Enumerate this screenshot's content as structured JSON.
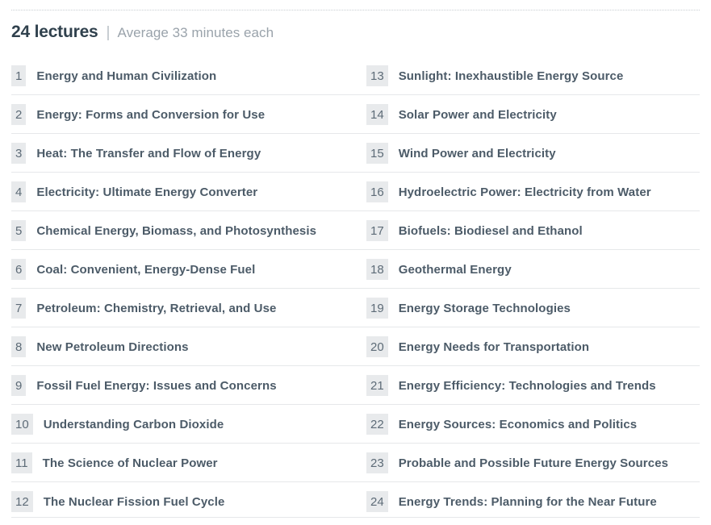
{
  "header": {
    "count_label": "24 lectures",
    "separator": "|",
    "average_label": "Average 33 minutes each"
  },
  "colors": {
    "heading": "#30414d",
    "muted": "#9aa3ab",
    "title": "#4c5b68",
    "badge_bg": "#e8eaec",
    "badge_text": "#5d6b77",
    "divider": "#e6e8ea",
    "dotted_rule": "#c9ced3",
    "background": "#ffffff"
  },
  "lectures": {
    "left_column": [
      {
        "number": "1",
        "title": "Energy and Human Civilization"
      },
      {
        "number": "2",
        "title": "Energy: Forms and Conversion for Use"
      },
      {
        "number": "3",
        "title": "Heat: The Transfer and Flow of Energy"
      },
      {
        "number": "4",
        "title": "Electricity: Ultimate Energy Converter"
      },
      {
        "number": "5",
        "title": "Chemical Energy, Biomass, and Photosynthesis"
      },
      {
        "number": "6",
        "title": "Coal: Convenient, Energy-Dense Fuel"
      },
      {
        "number": "7",
        "title": "Petroleum: Chemistry, Retrieval, and Use"
      },
      {
        "number": "8",
        "title": "New Petroleum Directions"
      },
      {
        "number": "9",
        "title": "Fossil Fuel Energy: Issues and Concerns"
      },
      {
        "number": "10",
        "title": "Understanding Carbon Dioxide"
      },
      {
        "number": "11",
        "title": "The Science of Nuclear Power"
      },
      {
        "number": "12",
        "title": "The Nuclear Fission Fuel Cycle"
      }
    ],
    "right_column": [
      {
        "number": "13",
        "title": "Sunlight: Inexhaustible Energy Source"
      },
      {
        "number": "14",
        "title": "Solar Power and Electricity"
      },
      {
        "number": "15",
        "title": "Wind Power and Electricity"
      },
      {
        "number": "16",
        "title": "Hydroelectric Power: Electricity from Water"
      },
      {
        "number": "17",
        "title": "Biofuels: Biodiesel and Ethanol"
      },
      {
        "number": "18",
        "title": "Geothermal Energy"
      },
      {
        "number": "19",
        "title": "Energy Storage Technologies"
      },
      {
        "number": "20",
        "title": "Energy Needs for Transportation"
      },
      {
        "number": "21",
        "title": "Energy Efficiency: Technologies and Trends"
      },
      {
        "number": "22",
        "title": "Energy Sources: Economics and Politics"
      },
      {
        "number": "23",
        "title": "Probable and Possible Future Energy Sources"
      },
      {
        "number": "24",
        "title": "Energy Trends: Planning for the Near Future"
      }
    ]
  }
}
